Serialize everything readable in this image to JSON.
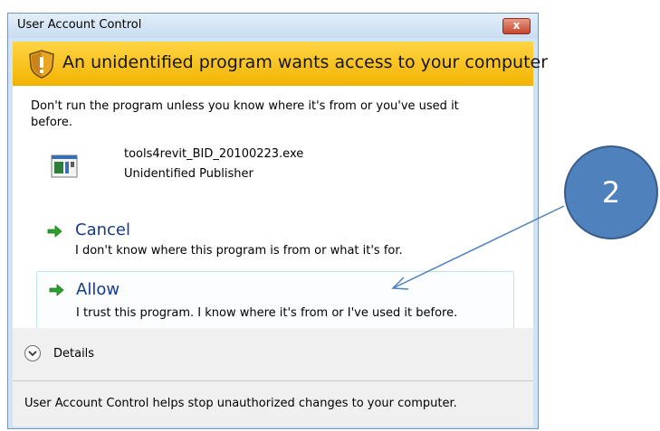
{
  "window": {
    "title": "User Account Control",
    "close_glyph": "x"
  },
  "banner": {
    "icon": "shield-warning-icon",
    "text": "An unidentified program wants access to your computer"
  },
  "description": "Don't run the program unless you know where it's from or you've used it before.",
  "program": {
    "icon": "application-file-icon",
    "file_name": "tools4revit_BID_20100223.exe",
    "publisher": "Unidentified Publisher"
  },
  "options": {
    "cancel": {
      "icon": "green-arrow-icon",
      "title": "Cancel",
      "subtitle": "I don't know where this program is from or what it's for."
    },
    "allow": {
      "icon": "green-arrow-icon",
      "title": "Allow",
      "subtitle": "I trust this program. I know where it's from or I've used it before."
    }
  },
  "details": {
    "icon": "chevron-down-circle-icon",
    "label": "Details"
  },
  "footer": {
    "text": "User Account Control helps stop unauthorized changes to your computer."
  },
  "callout": {
    "number": "2"
  },
  "colors": {
    "banner": "#f6bf1b",
    "link": "#153b8c",
    "callout": "#4f81bd",
    "arrow_green": "#2aa12a"
  }
}
